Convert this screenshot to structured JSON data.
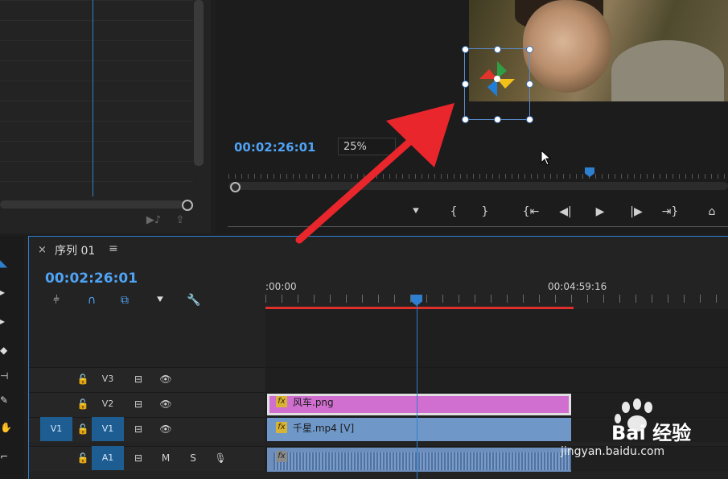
{
  "program": {
    "timecode": "00:02:26:01",
    "zoom": "25%"
  },
  "sequence": {
    "tab_title": "序列 01",
    "timecode": "00:02:26:01",
    "ruler_start": ":00:00",
    "ruler_mark": "00:04:59:16"
  },
  "tracks": [
    {
      "name": "V3",
      "source": ""
    },
    {
      "name": "V2",
      "source": ""
    },
    {
      "name": "V1",
      "source": "V1"
    },
    {
      "name": "A1",
      "source": "",
      "mute": "M",
      "solo": "S"
    }
  ],
  "clips": {
    "png": {
      "fx": "fx",
      "label": "风车.png"
    },
    "mp4": {
      "fx": "fx",
      "label": "千星.mp4 [V]"
    },
    "audio": {
      "fx": "fx"
    }
  },
  "watermark": {
    "brand": "Bai  经验",
    "url": "jingyan.baidu.com"
  },
  "colors": {
    "accent": "#2f7fd1",
    "timecode": "#4fa3f5",
    "work_area": "#e0302b",
    "clip_png": "#d06fd0",
    "clip_video": "#6f98c9"
  },
  "icons": {
    "close": "close-icon",
    "menu": "hamburger-menu-icon",
    "marker": "marker-icon",
    "wrench": "wrench-icon",
    "lock": "lock-icon",
    "eye": "eye-icon",
    "sync": "sync-lock-icon",
    "mic": "microphone-icon"
  }
}
